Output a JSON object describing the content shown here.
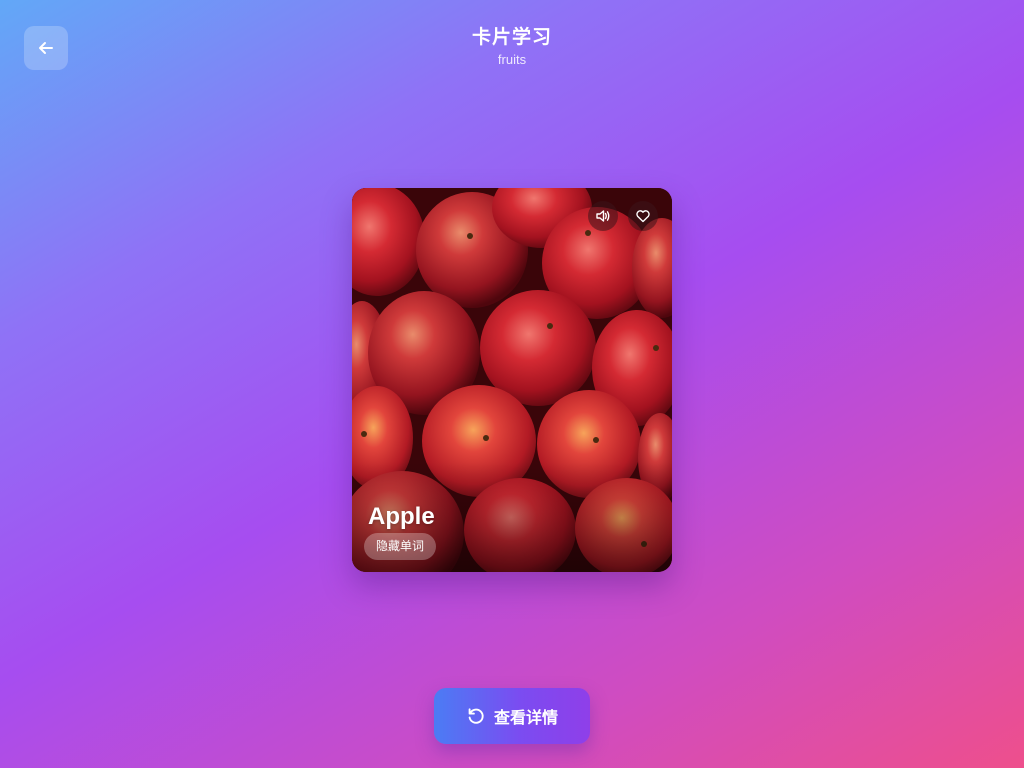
{
  "header": {
    "title": "卡片学习",
    "subtitle": "fruits"
  },
  "back_button": {
    "icon": "arrow-left-icon"
  },
  "card": {
    "word": "Apple",
    "hide_word_label": "隐藏单词",
    "image_subject": "red apples",
    "speaker_icon": "speaker-icon",
    "favorite_icon": "heart-icon"
  },
  "details_button": {
    "label": "查看详情",
    "icon": "rotate-icon"
  },
  "colors": {
    "gradient_start": "#62a8f7",
    "gradient_mid": "#a64df0",
    "gradient_end": "#ee4f8c",
    "button_start": "#4b7cf4",
    "button_end": "#8f3fe9"
  }
}
